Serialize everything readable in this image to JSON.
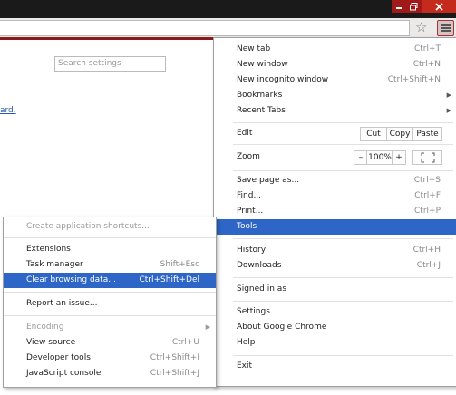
{
  "window": {
    "min_icon": "minimize-icon",
    "max_icon": "maximize-icon",
    "close_icon": "close-icon"
  },
  "toolbar": {
    "bookmark_icon": "star-icon",
    "menu_icon": "hamburger-menu-icon"
  },
  "page": {
    "search_placeholder": "Search settings",
    "link_fragment": "ard."
  },
  "colors": {
    "highlight": "#2d66c6",
    "frame": "#8b1a1a",
    "titlebar": "#1a1a1a"
  },
  "main_menu": {
    "new_tab": {
      "label": "New tab",
      "shortcut": "Ctrl+T"
    },
    "new_window": {
      "label": "New window",
      "shortcut": "Ctrl+N"
    },
    "incognito": {
      "label": "New incognito window",
      "shortcut": "Ctrl+Shift+N"
    },
    "bookmarks": {
      "label": "Bookmarks"
    },
    "recent_tabs": {
      "label": "Recent Tabs"
    },
    "edit": {
      "label": "Edit",
      "cut": "Cut",
      "copy": "Copy",
      "paste": "Paste"
    },
    "zoom": {
      "label": "Zoom",
      "minus": "–",
      "level": "100%",
      "plus": "+"
    },
    "save_page": {
      "label": "Save page as...",
      "shortcut": "Ctrl+S"
    },
    "find": {
      "label": "Find...",
      "shortcut": "Ctrl+F"
    },
    "print": {
      "label": "Print...",
      "shortcut": "Ctrl+P"
    },
    "tools": {
      "label": "Tools"
    },
    "history": {
      "label": "History",
      "shortcut": "Ctrl+H"
    },
    "downloads": {
      "label": "Downloads",
      "shortcut": "Ctrl+J"
    },
    "signed_in": {
      "label": "Signed in as"
    },
    "settings": {
      "label": "Settings"
    },
    "about": {
      "label": "About Google Chrome"
    },
    "help": {
      "label": "Help"
    },
    "exit": {
      "label": "Exit"
    }
  },
  "tools_menu": {
    "create_shortcuts": {
      "label": "Create application shortcuts..."
    },
    "extensions": {
      "label": "Extensions"
    },
    "task_manager": {
      "label": "Task manager",
      "shortcut": "Shift+Esc"
    },
    "clear_data": {
      "label": "Clear browsing data...",
      "shortcut": "Ctrl+Shift+Del"
    },
    "report_issue": {
      "label": "Report an issue..."
    },
    "encoding": {
      "label": "Encoding"
    },
    "view_source": {
      "label": "View source",
      "shortcut": "Ctrl+U"
    },
    "dev_tools": {
      "label": "Developer tools",
      "shortcut": "Ctrl+Shift+I"
    },
    "js_console": {
      "label": "JavaScript console",
      "shortcut": "Ctrl+Shift+J"
    }
  }
}
